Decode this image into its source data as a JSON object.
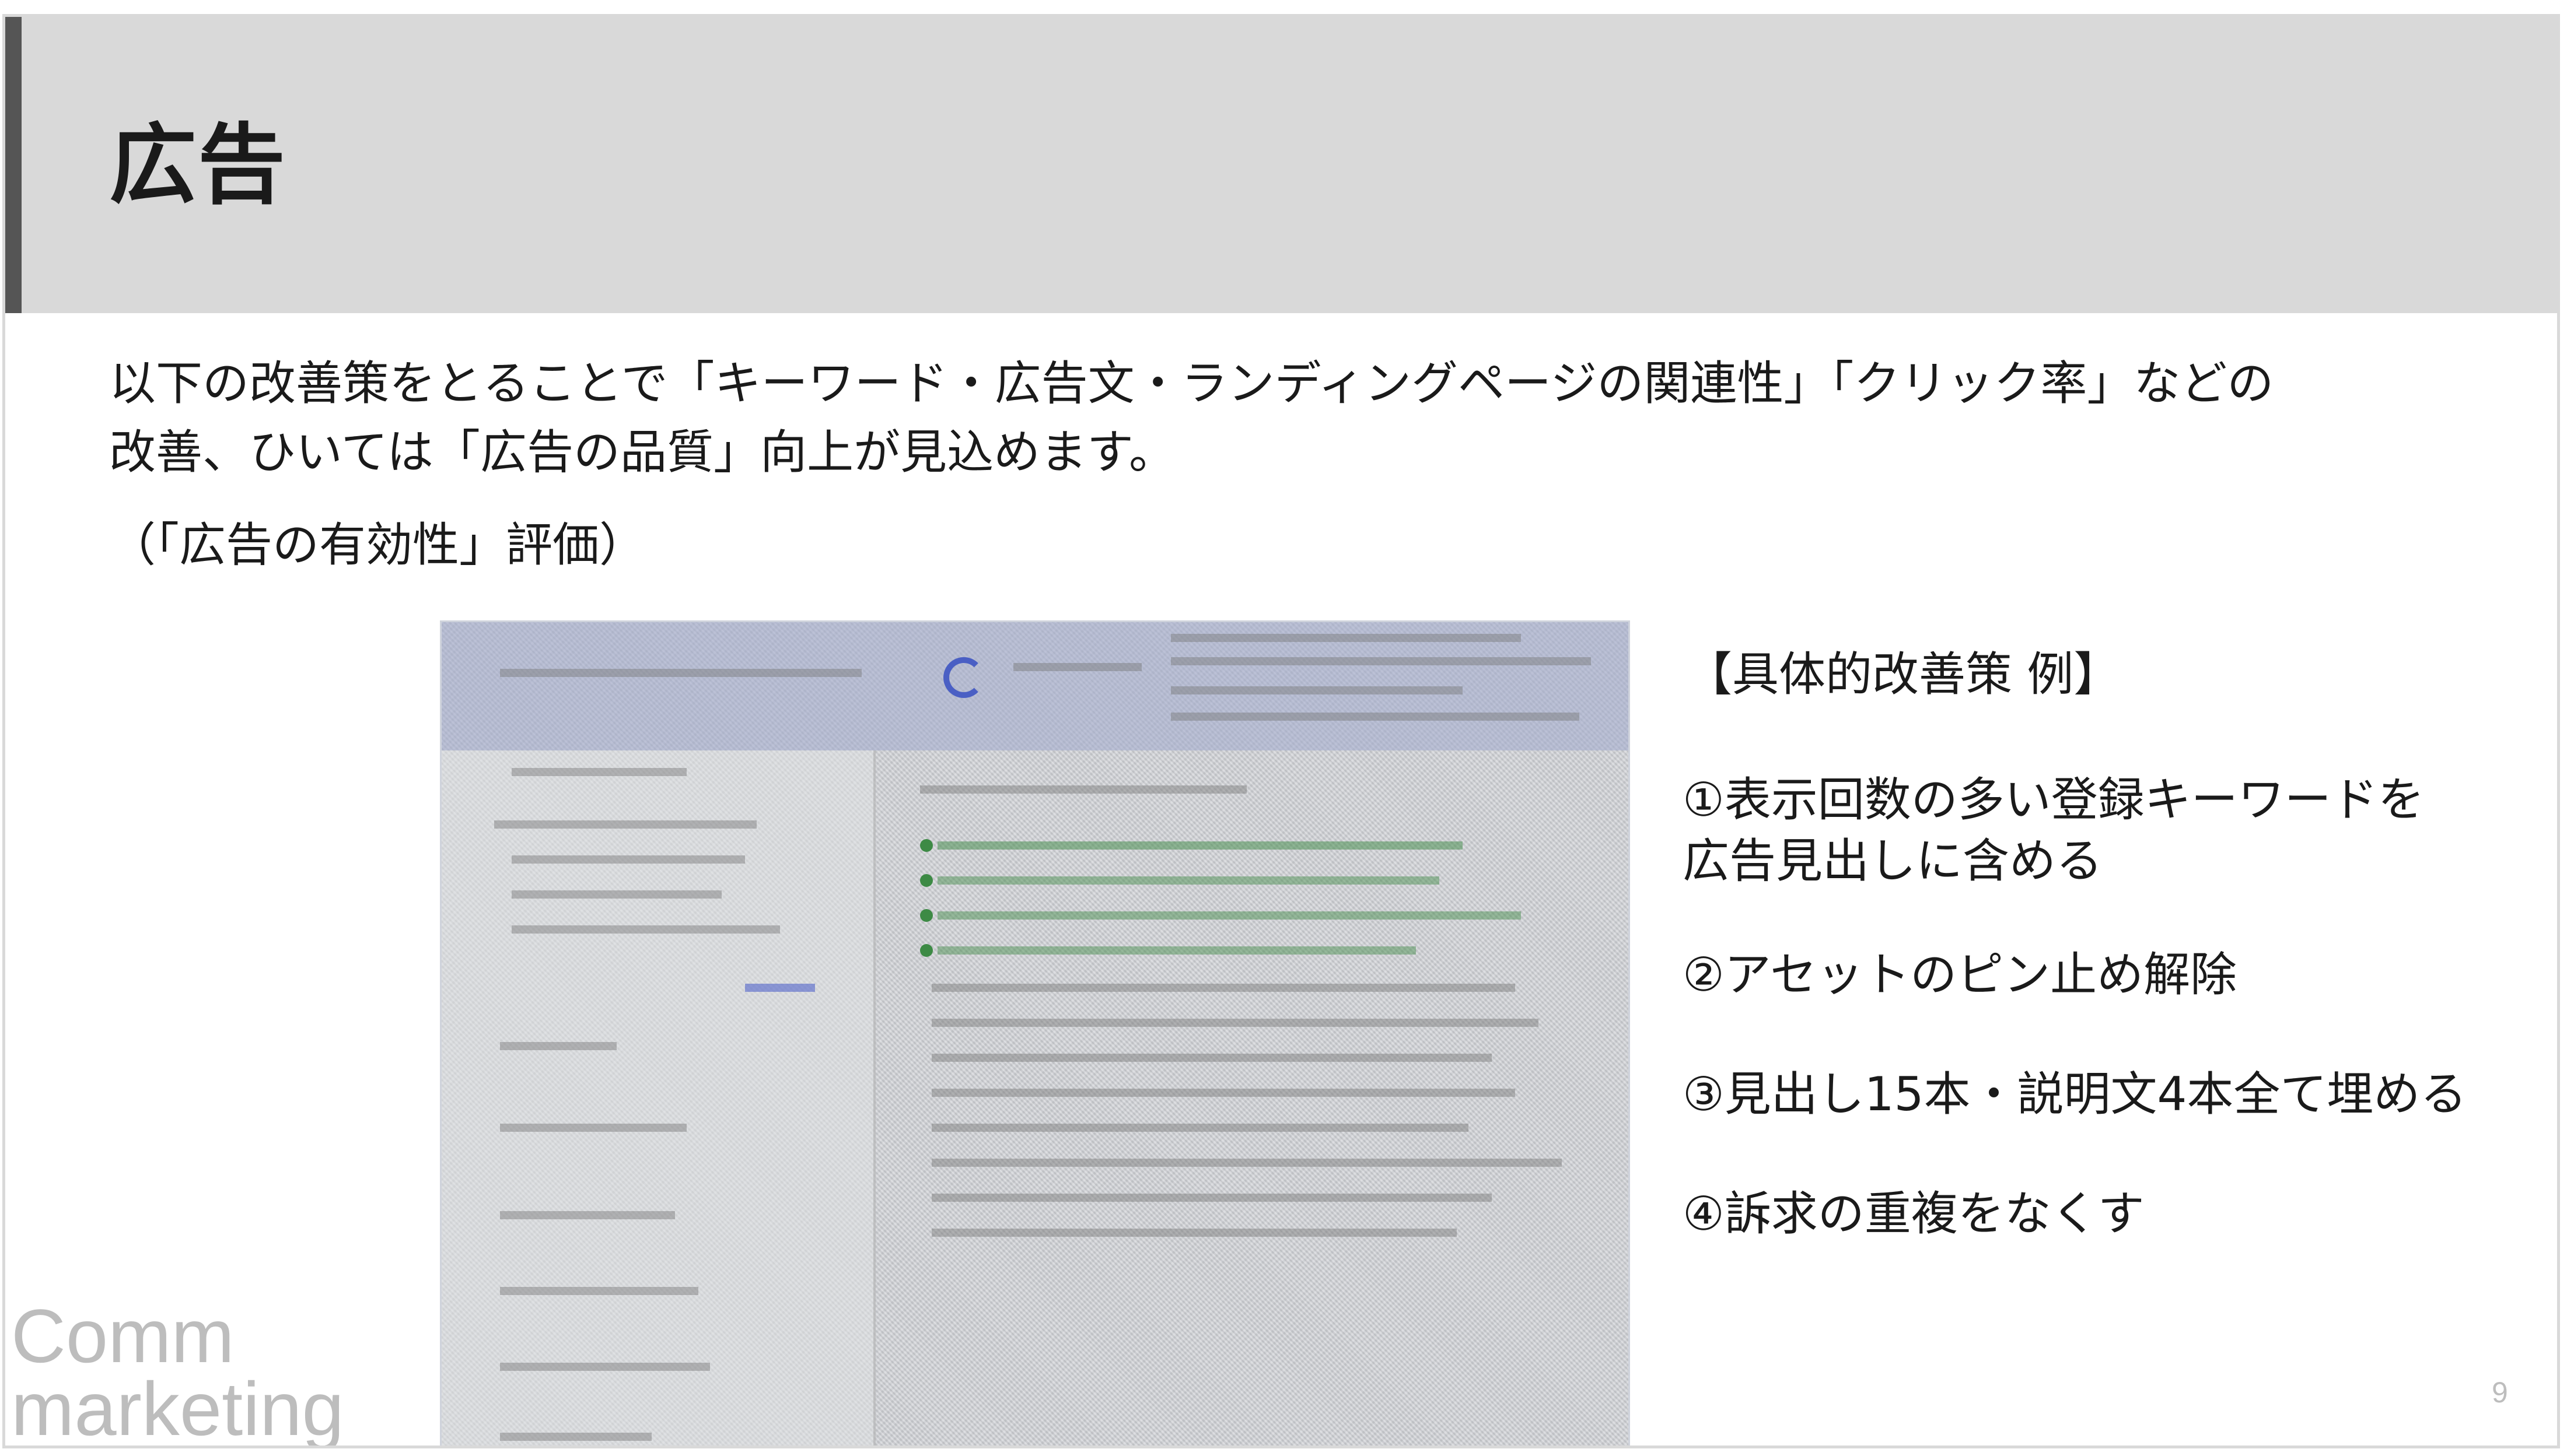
{
  "slide": {
    "title": "広告",
    "intro_line1": "以下の改善策をとることで「キーワード・広告文・ランディングページの関連性」「クリック率」などの",
    "intro_line2": "改善、ひいては「広告の品質」向上が見込めます。",
    "subnote": "（「広告の有効性」評価）",
    "tips_heading": "【具体的改善策 例】",
    "tips": [
      {
        "line1": "①表示回数の多い登録キーワードを",
        "line2": "広告見出しに含める"
      },
      {
        "line1": "②アセットのピン止め解除"
      },
      {
        "line1": "③見出し15本・説明文4本全て埋める"
      },
      {
        "line1": "④訴求の重複をなくす"
      }
    ],
    "watermark_line1": "Comm",
    "watermark_line2": "marketing",
    "page_number": "9"
  },
  "colors": {
    "header_bg": "#d9d9d9",
    "header_bar": "#555555",
    "text": "#1a1a1a",
    "watermark": "#bdbdbd",
    "asset_dot": "#3d8a45",
    "spinner": "#4a5fc4"
  }
}
